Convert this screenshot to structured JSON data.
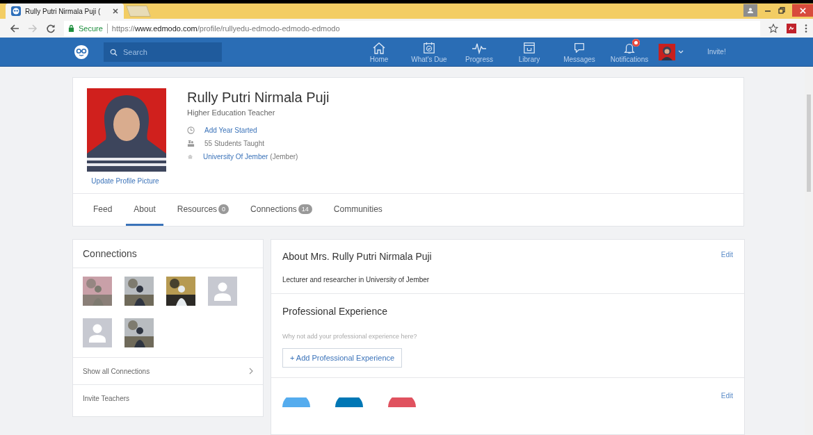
{
  "browser": {
    "tab_title": "Rully Putri Nirmala Puji (",
    "secure_label": "Secure",
    "url_scheme": "https://",
    "url_host": "www.edmodo.com",
    "url_path": "/profile/rullyedu-edmodo-edmodo-edmodo"
  },
  "navbar": {
    "search": {
      "placeholder": "Search"
    },
    "items": [
      {
        "kind": "home",
        "label": "Home"
      },
      {
        "kind": "due",
        "label": "What's Due"
      },
      {
        "kind": "progress",
        "label": "Progress"
      },
      {
        "kind": "library",
        "label": "Library"
      },
      {
        "kind": "messages",
        "label": "Messages"
      },
      {
        "kind": "notifications",
        "label": "Notifications",
        "badge": true
      }
    ],
    "invite": "Invite!"
  },
  "profile": {
    "name": "Rully Putri Nirmala Puji",
    "role": "Higher Education Teacher",
    "update_picture": "Update Profile Picture",
    "details": [
      {
        "kind": "clock",
        "text": "Add Year Started",
        "link": true
      },
      {
        "kind": "students",
        "text": "55 Students Taught",
        "link": false
      },
      {
        "kind": "school",
        "text": "University Of Jember",
        "suffix": "(Jember)",
        "link": true
      }
    ]
  },
  "tabs": [
    {
      "label": "Feed",
      "selected": false
    },
    {
      "label": "About",
      "selected": true
    },
    {
      "label": "Resources",
      "count": "0",
      "selected": false
    },
    {
      "label": "Connections",
      "count": "14",
      "selected": false
    },
    {
      "label": "Communities",
      "selected": false
    }
  ],
  "connections": {
    "title": "Connections",
    "people": [
      {
        "kind": "picture"
      },
      {
        "kind": "picture"
      },
      {
        "kind": "picture"
      },
      {
        "kind": "default"
      },
      {
        "kind": "default"
      },
      {
        "kind": "picture"
      }
    ],
    "show_all": "Show all Connections",
    "invite": "Invite Teachers"
  },
  "about": {
    "title": "About Mrs. Rully Putri Nirmala Puji",
    "edit": "Edit",
    "text": "Lecturer and researcher in University of Jember"
  },
  "experience": {
    "title": "Professional Experience",
    "hint": "Why not add your professional experience here?",
    "button": "+ Add Professional Experience"
  },
  "social": {
    "edit": "Edit",
    "networks": [
      {
        "color": "#55acee"
      },
      {
        "color": "#0077b5"
      },
      {
        "color": "#e0525f"
      }
    ]
  }
}
